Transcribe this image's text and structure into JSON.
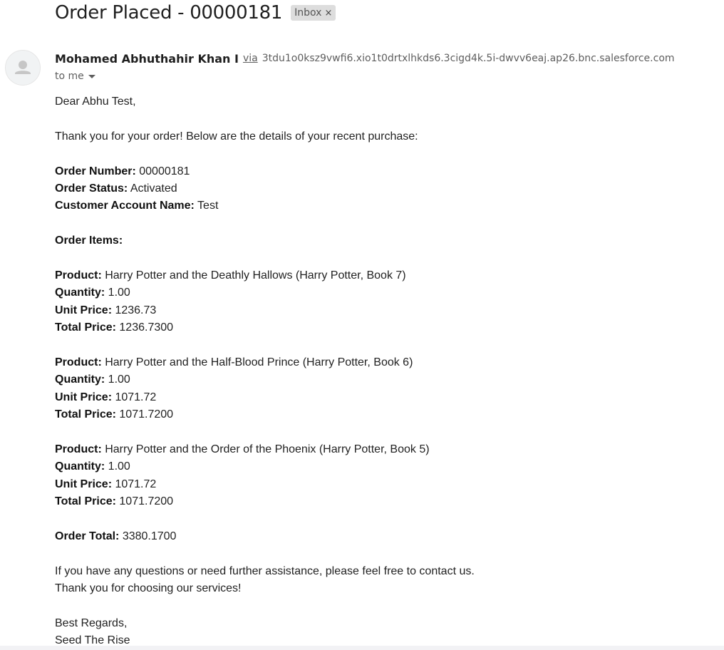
{
  "email": {
    "subject": "Order Placed - 00000181",
    "label": "Inbox",
    "label_close": "×",
    "sender_name": "Mohamed Abhuthahir Khan I",
    "via_text": "via",
    "via_address": "3tdu1o0ksz9vwfi6.xio1t0drtxlhkds6.3cigd4k.5i-dwvv6eaj.ap26.bnc.salesforce.com",
    "to_text": "to me"
  },
  "body": {
    "greeting": "Dear Abhu Test,",
    "intro": "Thank you for your order! Below are the details of your recent purchase:",
    "order_number_label": "Order Number:",
    "order_number": " 00000181",
    "order_status_label": "Order Status:",
    "order_status": " Activated",
    "account_label": "Customer Account Name:",
    "account_name": " Test",
    "items_heading": "Order Items:",
    "product_label": "Product:",
    "quantity_label": "Quantity:",
    "unit_price_label": "Unit Price:",
    "total_price_label": "Total Price:",
    "items": [
      {
        "product": " Harry Potter and the Deathly Hallows (Harry Potter, Book 7)",
        "quantity": " 1.00",
        "unit_price": " 1236.73",
        "total_price": " 1236.7300"
      },
      {
        "product": " Harry Potter and the Half-Blood Prince (Harry Potter, Book 6)",
        "quantity": " 1.00",
        "unit_price": " 1071.72",
        "total_price": " 1071.7200"
      },
      {
        "product": " Harry Potter and the Order of the Phoenix (Harry Potter, Book 5)",
        "quantity": " 1.00",
        "unit_price": " 1071.72",
        "total_price": " 1071.7200"
      }
    ],
    "order_total_label": "Order Total:",
    "order_total": " 3380.1700",
    "closing_1": "If you have any questions or need further assistance, please feel free to contact us.",
    "closing_2": "Thank you for choosing our services!",
    "regards": "Best Regards,",
    "company": "Seed The Rise"
  },
  "icons": {
    "avatar": "person-avatar-icon",
    "label_close": "close-icon",
    "recipient_details": "chevron-down-icon"
  },
  "colors": {
    "label_chip_bg": "#dddddd",
    "avatar_bg": "#f1f3f4",
    "secondary_text": "#5e5e5e"
  }
}
